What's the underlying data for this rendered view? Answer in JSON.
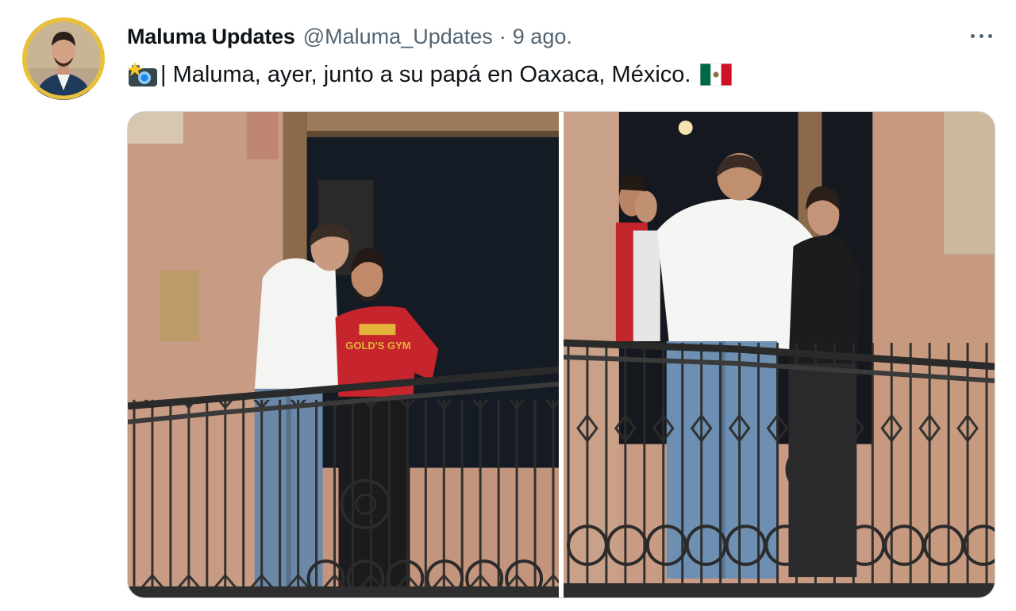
{
  "tweet": {
    "author_name": "Maluma Updates",
    "author_handle": "@Maluma_Updates",
    "separator": "·",
    "timestamp": "9 ago.",
    "text": "| Maluma, ayer, junto a su papá en Oaxaca, México.",
    "leading_icon": "camera-with-flash-icon",
    "trailing_icon": "mexico-flag-icon",
    "more_icon": "more-options-icon",
    "shirt_text": "GOLD'S GYM"
  },
  "media": [
    {
      "description_icon": "photo",
      "name": "balcony-photo-left"
    },
    {
      "description_icon": "photo",
      "name": "balcony-photo-right"
    }
  ],
  "colors": {
    "text_primary": "#0f1419",
    "text_secondary": "#536471",
    "avatar_ring": "#e9c03a"
  }
}
